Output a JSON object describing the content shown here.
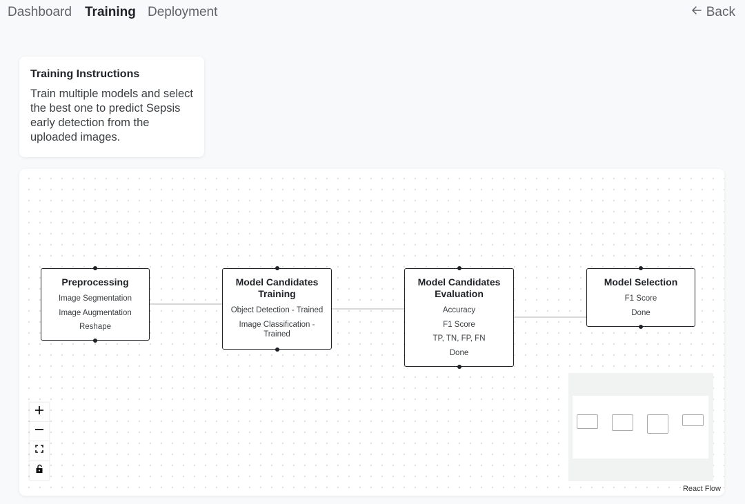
{
  "nav": {
    "tabs": [
      {
        "label": "Dashboard",
        "active": false
      },
      {
        "label": "Training",
        "active": true
      },
      {
        "label": "Deployment",
        "active": false
      }
    ],
    "back_label": "Back",
    "back_icon": "arrow-left-icon"
  },
  "instructions": {
    "title": "Training Instructions",
    "body": "Train multiple models and select the best one to predict Sepsis early detection from the uploaded images."
  },
  "flow": {
    "nodes": [
      {
        "id": "preprocessing",
        "title": "Preprocessing",
        "items": [
          "Image Segmentation",
          "Image Augmentation",
          "Reshape"
        ]
      },
      {
        "id": "training",
        "title": "Model Candidates Training",
        "items": [
          "Object Detection - Trained",
          "Image Classification - Trained"
        ]
      },
      {
        "id": "evaluation",
        "title": "Model Candidates Evaluation",
        "items": [
          "Accuracy",
          "F1 Score",
          "TP, TN, FP, FN",
          "Done"
        ]
      },
      {
        "id": "selection",
        "title": "Model Selection",
        "items": [
          "F1 Score",
          "Done"
        ]
      }
    ],
    "edges": [
      {
        "from": "preprocessing",
        "to": "training"
      },
      {
        "from": "training",
        "to": "evaluation"
      },
      {
        "from": "evaluation",
        "to": "selection"
      }
    ],
    "controls": [
      {
        "name": "zoom-in",
        "icon": "plus-icon"
      },
      {
        "name": "zoom-out",
        "icon": "minus-icon"
      },
      {
        "name": "fit-view",
        "icon": "fullscreen-icon"
      },
      {
        "name": "toggle-interactivity",
        "icon": "lock-icon"
      }
    ],
    "attribution": "React Flow"
  }
}
